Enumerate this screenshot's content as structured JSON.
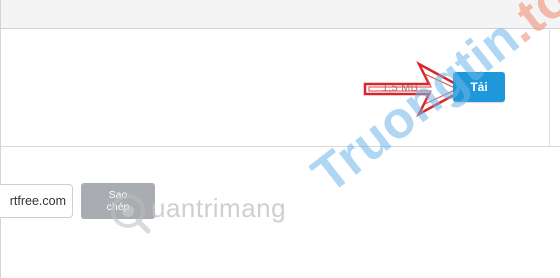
{
  "header": {
    "title": ""
  },
  "download": {
    "file_size": "1,5 MB",
    "button_label": "Tải"
  },
  "share": {
    "link_value": "rtfree.com",
    "copy_label": "Sao chép"
  },
  "watermarks": {
    "quantrimang": "uantrimang",
    "truongtin": "Truongtin",
    "truongtin_tail": ".top"
  },
  "colors": {
    "accent": "#1e98da",
    "arrow": "#d8262b",
    "copy_button": "#a9adb2"
  },
  "icons": {
    "arrow": "red-arrow-icon",
    "logo": "quantrimang-logo-icon"
  }
}
